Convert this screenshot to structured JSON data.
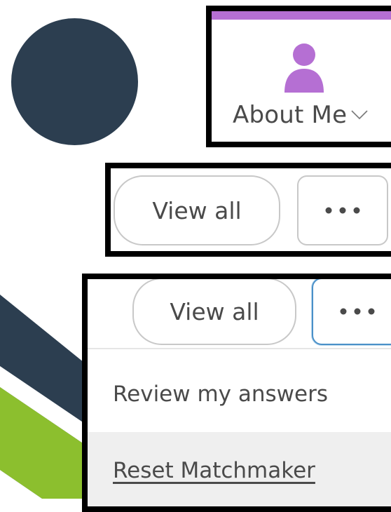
{
  "colors": {
    "dark_navy": "#2c3e50",
    "accent_green": "#8cbf2e",
    "purple": "#b56fd3",
    "text_gray": "#4a4a4a",
    "border_gray": "#c8c8c8",
    "focus_blue": "#4a90c8",
    "hover_gray": "#efefef"
  },
  "about_panel": {
    "label": "About Me",
    "avatar_icon": "person-icon",
    "chevron_icon": "chevron-down-icon"
  },
  "viewall_panel": {
    "view_all_label": "View all",
    "more_icon": "ellipsis-icon"
  },
  "menu_panel": {
    "view_all_label": "View all",
    "more_icon": "ellipsis-icon",
    "items": [
      {
        "label": "Review my answers"
      },
      {
        "label": "Reset Matchmaker"
      }
    ]
  }
}
